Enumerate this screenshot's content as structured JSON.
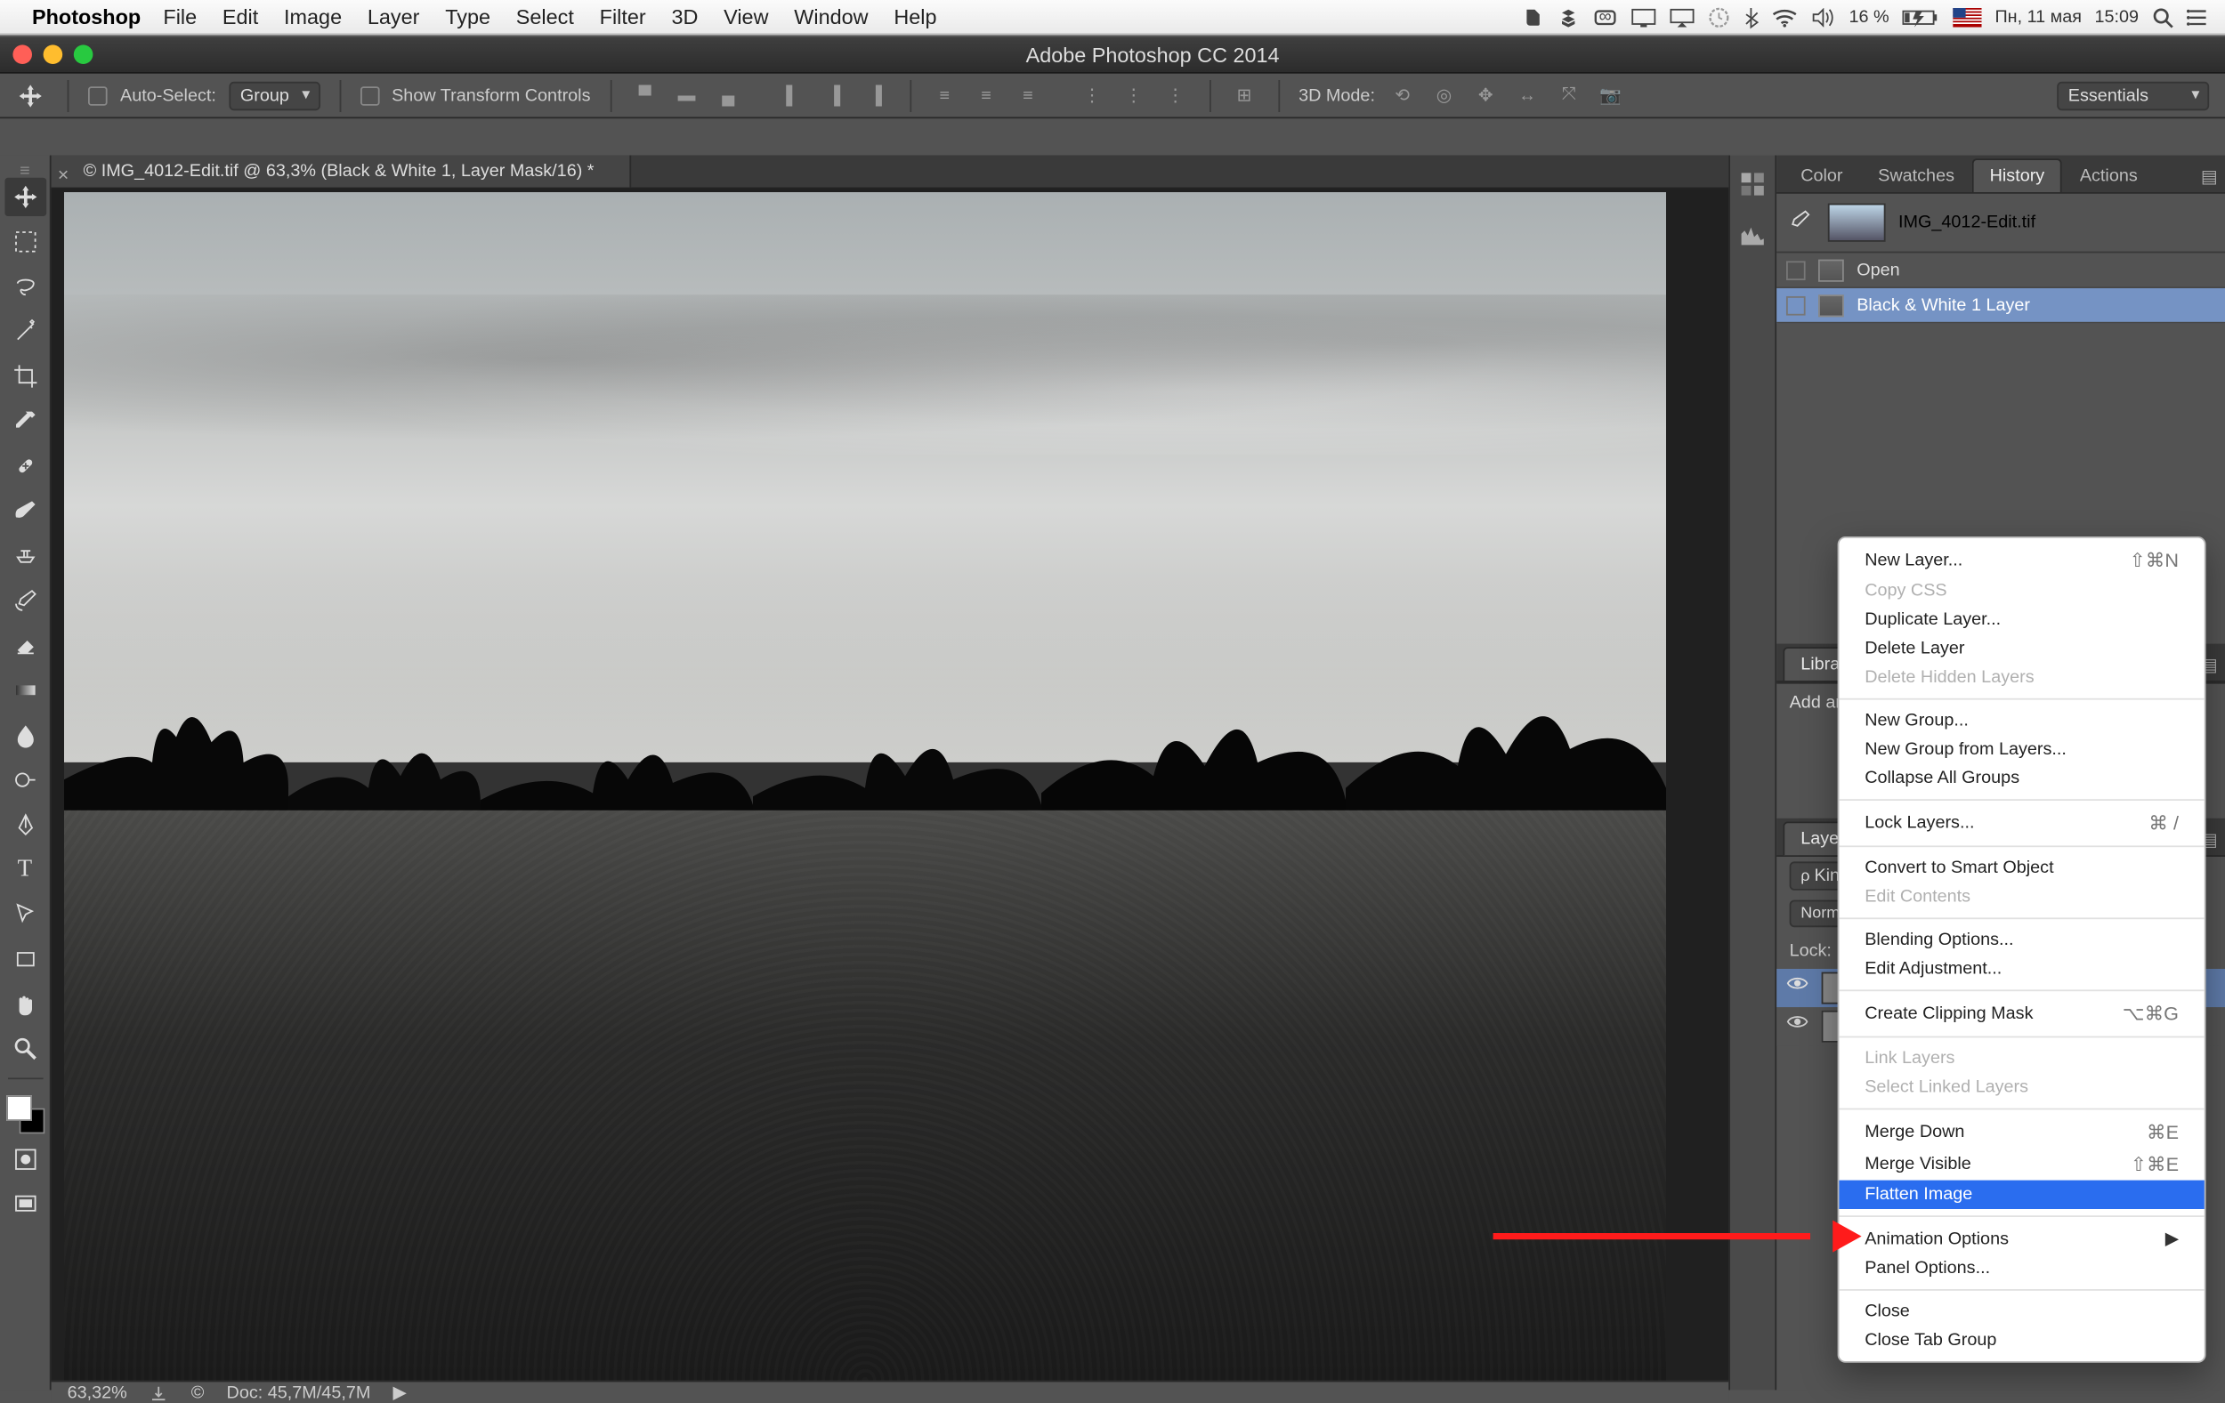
{
  "mac_menu": {
    "app_name": "Photoshop",
    "items": [
      "File",
      "Edit",
      "Image",
      "Layer",
      "Type",
      "Select",
      "Filter",
      "3D",
      "View",
      "Window",
      "Help"
    ],
    "battery": "16 %",
    "date": "Пн, 11 мая",
    "time": "15:09"
  },
  "window_title": "Adobe Photoshop CC 2014",
  "options": {
    "auto_select": "Auto-Select:",
    "group": "Group",
    "show_transform": "Show Transform Controls",
    "mode3d": "3D Mode:",
    "workspace": "Essentials"
  },
  "doc_tab": "© IMG_4012-Edit.tif @ 63,3% (Black & White 1, Layer Mask/16) *",
  "status": {
    "zoom": "63,32%",
    "doc": "Doc: 45,7M/45,7M"
  },
  "panel_tabs": {
    "color": "Color",
    "swatches": "Swatches",
    "history": "History",
    "actions": "Actions"
  },
  "history": {
    "doc_name": "IMG_4012-Edit.tif",
    "rows": [
      "Open",
      "Black & White 1 Layer"
    ]
  },
  "libraries": {
    "label": "Libraries",
    "add": "Add ar"
  },
  "layers_panel": {
    "layers": "Layers",
    "kind": "Kind",
    "normal": "Normal",
    "lock": "Lock:"
  },
  "context_menu": {
    "new_layer": "New Layer...",
    "sc_new": "⇧⌘N",
    "copy_css": "Copy CSS",
    "dup": "Duplicate Layer...",
    "del": "Delete Layer",
    "del_hidden": "Delete Hidden Layers",
    "new_group": "New Group...",
    "new_group_from": "New Group from Layers...",
    "collapse": "Collapse All Groups",
    "lock": "Lock Layers...",
    "sc_lock": "⌘ /",
    "convert": "Convert to Smart Object",
    "edit_contents": "Edit Contents",
    "blend": "Blending Options...",
    "edit_adj": "Edit Adjustment...",
    "clip": "Create Clipping Mask",
    "sc_clip": "⌥⌘G",
    "link": "Link Layers",
    "sel_linked": "Select Linked Layers",
    "merge_down": "Merge Down",
    "sc_md": "⌘E",
    "merge_vis": "Merge Visible",
    "sc_mv": "⇧⌘E",
    "flatten": "Flatten Image",
    "anim": "Animation Options",
    "panel_opt": "Panel Options...",
    "close": "Close",
    "close_tab": "Close Tab Group"
  }
}
